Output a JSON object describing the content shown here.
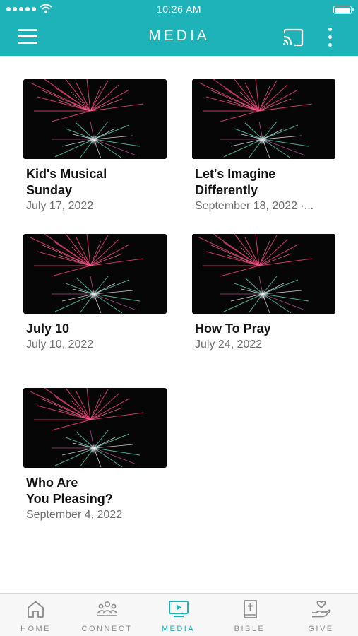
{
  "status_bar": {
    "time": "10:26 AM"
  },
  "header": {
    "title": "MEDIA",
    "icons": [
      "menu-icon",
      "cast-icon",
      "more-vertical-icon"
    ]
  },
  "colors": {
    "accent": "#1db3b8",
    "tab_inactive": "#8a8a8a",
    "date_text": "#6e6e6e"
  },
  "media": {
    "items": [
      {
        "title": "Kid's Musical\nSunday",
        "date": "July 17, 2022"
      },
      {
        "title": "Let's Imagine\nDifferently",
        "date": "September 18, 2022 ·..."
      },
      {
        "title": "July 10",
        "date": "July 10, 2022"
      },
      {
        "title": "How To Pray",
        "date": "July 24, 2022"
      },
      {
        "title": "Who Are\nYou Pleasing?",
        "date": "September 4, 2022"
      }
    ]
  },
  "tabbar": {
    "tabs": [
      {
        "label": "HOME",
        "icon": "home-icon",
        "active": false
      },
      {
        "label": "CONNECT",
        "icon": "people-icon",
        "active": false
      },
      {
        "label": "MEDIA",
        "icon": "media-play-icon",
        "active": true
      },
      {
        "label": "BIBLE",
        "icon": "bible-icon",
        "active": false
      },
      {
        "label": "GIVE",
        "icon": "give-hand-icon",
        "active": false
      }
    ]
  }
}
